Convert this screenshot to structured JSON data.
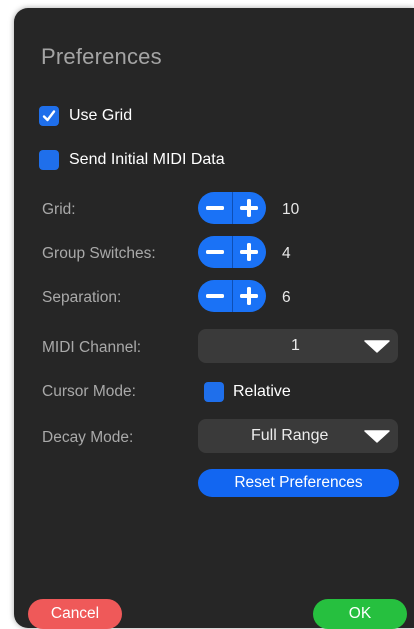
{
  "dialog": {
    "title": "Preferences"
  },
  "options": {
    "use_grid": {
      "label": "Use Grid",
      "checked": true,
      "icon": "checkmark-icon"
    },
    "send_initial_midi": {
      "label": "Send Initial MIDI Data",
      "checked": false
    }
  },
  "fields": {
    "grid": {
      "label": "Grid:",
      "value": "10"
    },
    "group_switches": {
      "label": "Group Switches:",
      "value": "4"
    },
    "separation": {
      "label": "Separation:",
      "value": "6"
    },
    "midi_channel": {
      "label": "MIDI Channel:",
      "value": "1"
    },
    "cursor_mode": {
      "label": "Cursor Mode:",
      "checkbox_label": "Relative",
      "checked": false
    },
    "decay_mode": {
      "label": "Decay Mode:",
      "value": "Full Range"
    }
  },
  "buttons": {
    "reset": "Reset Preferences",
    "cancel": "Cancel",
    "ok": "OK"
  },
  "icons": {
    "decrement": "minus-icon",
    "increment": "plus-icon",
    "dropdown": "triangle-down-icon"
  },
  "colors": {
    "panel_bg": "#262626",
    "accent_blue": "#1a72f6",
    "cancel_red": "#ef5959",
    "ok_green": "#26c03f",
    "dropdown_bg": "#3a3a3a",
    "label_gray": "#a9a9a9"
  }
}
